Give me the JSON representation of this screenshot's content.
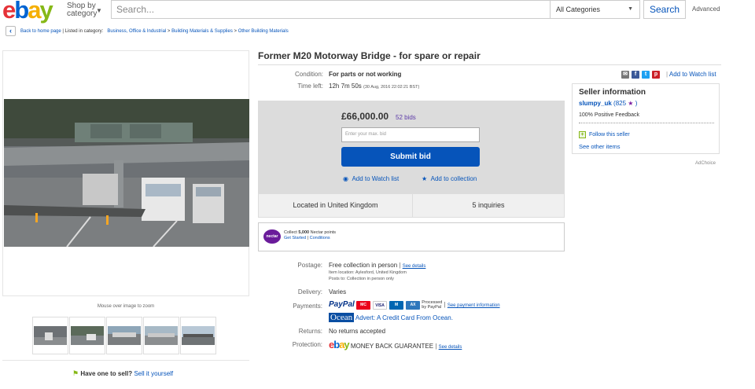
{
  "header": {
    "logo": "ebay",
    "shop_by": "Shop by",
    "category": "category",
    "search_placeholder": "Search...",
    "category_select": "All Categories",
    "search_button": "Search",
    "advanced": "Advanced"
  },
  "breadcrumb": {
    "back": "Back to home page",
    "listed": "| Listed in category:",
    "path": [
      "Business, Office & Industrial",
      "Building Materials & Supplies",
      "Other Building Materials"
    ],
    "sep": ">"
  },
  "images": {
    "zoom_hint": "Mouse over image to zoom",
    "thumbnail_count": 5
  },
  "sell": {
    "question": "Have one to sell?",
    "link": "Sell it yourself"
  },
  "item": {
    "title": "Former M20 Motorway Bridge - for spare or repair",
    "condition_label": "Condition:",
    "condition": "For parts or not working",
    "time_left_label": "Time left:",
    "time_left": "12h 7m 50s",
    "end_time": "(30 Aug, 2016  22:02:21 BST)"
  },
  "bid": {
    "price": "£66,000.00",
    "bids": "52 bids",
    "max_bid_placeholder": "Enter your max. bid",
    "submit": "Submit bid",
    "watch": "Add to Watch list",
    "collection": "Add to collection"
  },
  "location": {
    "located": "Located in United Kingdom",
    "inquiries": "5 inquiries"
  },
  "nectar": {
    "logo": "nectar",
    "collect_prefix": "Collect",
    "points": "5,000",
    "collect_suffix": "Nectar points",
    "get_started": "Get Started",
    "conditions": "Conditions"
  },
  "details": {
    "postage_label": "Postage:",
    "postage": "Free collection in person",
    "see_details": "See details",
    "item_location": "Item location:  Aylesford, United Kingdom",
    "posts_to": "Posts to:  Collection in person only",
    "delivery_label": "Delivery:",
    "delivery": "Varies",
    "payments_label": "Payments:",
    "paypal": "PayPal",
    "processed": "Processed",
    "by_paypal": "by PayPal",
    "see_payment": "See payment information",
    "ocean": "Ocean",
    "advert": "Advert: A Credit Card From Ocean.",
    "returns_label": "Returns:",
    "returns": "No returns accepted",
    "protection_label": "Protection:",
    "money_back": "MONEY BACK GUARANTEE",
    "protection_see": "See details"
  },
  "share": {
    "add_watch": "Add to Watch list"
  },
  "seller": {
    "heading": "Seller information",
    "username": "slumpy_uk",
    "score": "(825",
    "close": ")",
    "feedback": "100% Positive Feedback",
    "follow": "Follow this seller",
    "other_items": "See other items"
  },
  "adchoice": "AdChoice",
  "colors": {
    "link": "#0654ba",
    "submit": "#0654ba",
    "bid_box": "#dcdcdc",
    "bids": "#5d3aa8"
  }
}
